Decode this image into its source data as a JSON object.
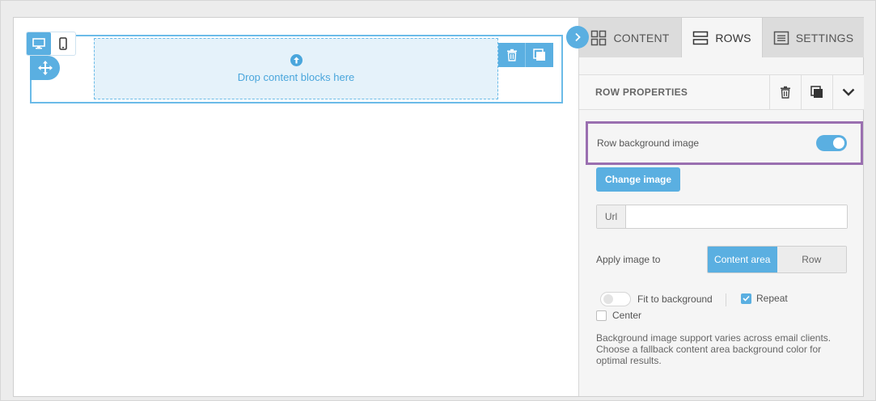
{
  "canvas": {
    "drop_text": "Drop content blocks here"
  },
  "tabs": [
    {
      "label": "CONTENT",
      "icon": "grid-icon"
    },
    {
      "label": "ROWS",
      "icon": "rows-icon"
    },
    {
      "label": "SETTINGS",
      "icon": "settings-icon"
    }
  ],
  "row_properties": {
    "title": "ROW PROPERTIES",
    "bg_image_label": "Row background image",
    "bg_image_enabled": true,
    "change_image_label": "Change image",
    "url_label": "Url",
    "url_value": "",
    "apply_label": "Apply image to",
    "apply_options": [
      "Content area",
      "Row"
    ],
    "apply_selected": "Content area",
    "fit_label": "Fit to background",
    "fit_enabled": false,
    "repeat_label": "Repeat",
    "repeat_checked": true,
    "center_label": "Center",
    "center_checked": false,
    "note": "Background image support varies across email clients. Choose a fallback content area background color for optimal results."
  },
  "colors": {
    "accent": "#5aafe1",
    "highlight_border": "#9a6fb0"
  }
}
